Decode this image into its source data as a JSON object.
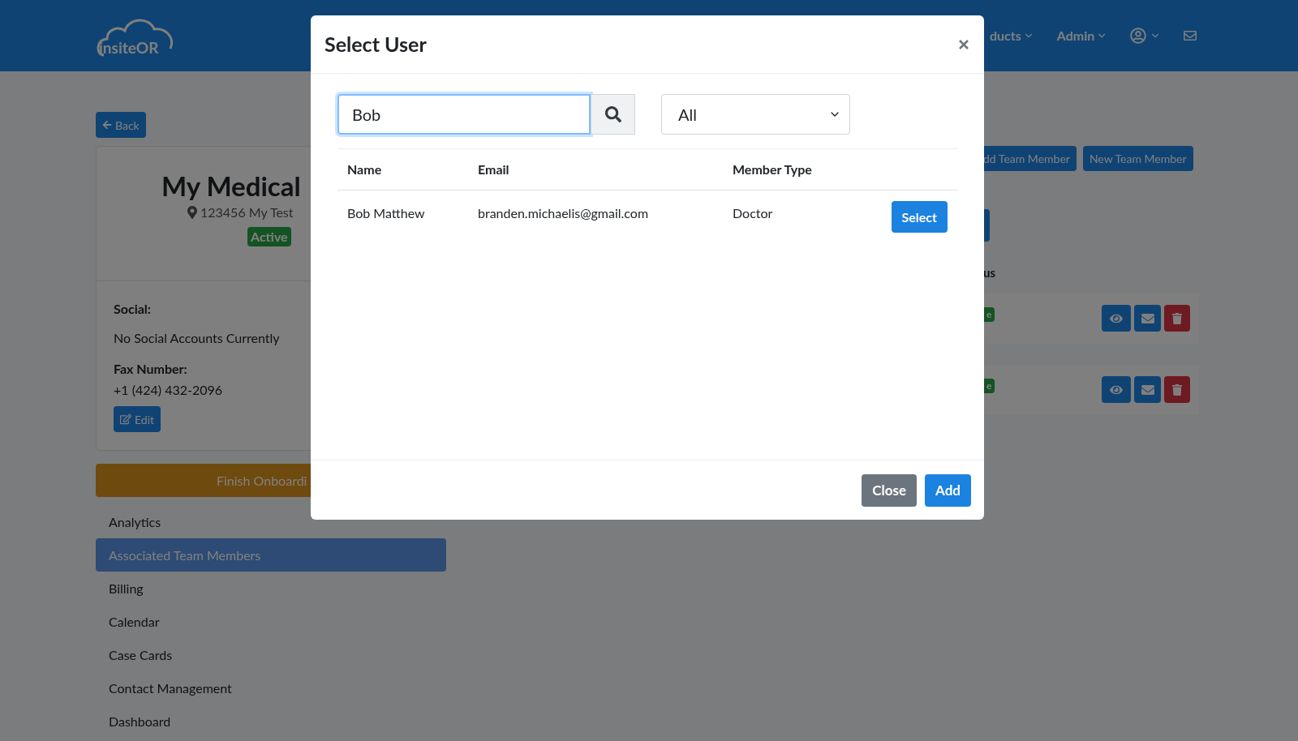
{
  "header": {
    "logo": "insiteOR",
    "nav": [
      {
        "kind": "dropdown",
        "label": "ducts"
      },
      {
        "kind": "dropdown",
        "label": "Admin"
      },
      {
        "kind": "user"
      },
      {
        "kind": "mail"
      }
    ]
  },
  "back_button": "Back",
  "profile": {
    "title": "My Medical",
    "address": "123456 My Test",
    "status": "Active",
    "social_label": "Social:",
    "social_value": "No Social Accounts Currently",
    "fax_label": "Fax Number:",
    "fax_value": "+1 (424) 432-2096",
    "edit_button": "Edit"
  },
  "onboarding_button": "Finish Onboardi",
  "sidebar": {
    "items": [
      {
        "label": "Analytics",
        "selected": false
      },
      {
        "label": "Associated Team Members",
        "selected": true
      },
      {
        "label": "Billing",
        "selected": false
      },
      {
        "label": "Calendar",
        "selected": false
      },
      {
        "label": "Case Cards",
        "selected": false
      },
      {
        "label": "Contact Management",
        "selected": false
      },
      {
        "label": "Dashboard",
        "selected": false
      }
    ]
  },
  "right_panel": {
    "buttons": [
      "dd Team Member",
      "New Team Member"
    ],
    "column_heading": "us",
    "rows": [
      {
        "status": "e"
      },
      {
        "status": "e"
      }
    ]
  },
  "modal": {
    "title": "Select User",
    "search": {
      "value": "Bob"
    },
    "filter": "All",
    "table": {
      "columns": [
        "Name",
        "Email",
        "Member Type"
      ],
      "rows": [
        {
          "name": "Bob Matthew",
          "email": "branden.michaelis@gmail.com",
          "member_type": "Doctor",
          "action": "Select"
        }
      ]
    },
    "footer_buttons": [
      {
        "kind": "secondary",
        "label": "Close"
      },
      {
        "kind": "primary",
        "label": "Add"
      }
    ]
  }
}
